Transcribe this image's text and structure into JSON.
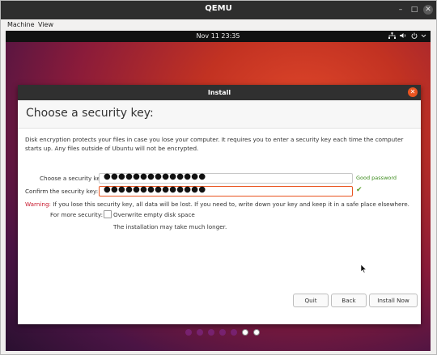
{
  "qemu": {
    "title": "QEMU",
    "minimize": "–",
    "maximize": "□",
    "close": "✕",
    "menu": [
      "Machine",
      "View"
    ]
  },
  "guest": {
    "clock": "Nov 11  23:35",
    "tray_icons": [
      "network-icon",
      "volume-icon",
      "power-icon",
      "chevron-down-icon"
    ]
  },
  "dialog": {
    "title": "Install",
    "close": "✕",
    "heading": "Choose a security key:",
    "description": "Disk encryption protects your files in case you lose your computer. It requires you to enter a security key each time the computer starts up. Any files outside of Ubuntu will not be encrypted.",
    "key_label": "Choose a security key:",
    "key_value": "●●●●●●●●●●●●●●",
    "strength": "Good password",
    "confirm_label": "Confirm the security key:",
    "confirm_value": "●●●●●●●●●●●●●●",
    "match_icon": "✔",
    "warning_prefix": "Warning:",
    "warning_text": " If you lose this security key, all data will be lost. If you need to, write down your key and keep it in a safe place elsewhere.",
    "more_security_label": "For more security:",
    "overwrite_label": "Overwrite empty disk space",
    "overwrite_note": "The installation may take much longer.",
    "overwrite_checked": false,
    "buttons": {
      "quit": "Quit",
      "back": "Back",
      "install": "Install Now"
    },
    "progress": {
      "total": 7,
      "completed": 5
    }
  },
  "colors": {
    "accent": "#e95420",
    "progress": "#77216f",
    "warning": "#c7162b",
    "good": "#3a8a1a"
  }
}
